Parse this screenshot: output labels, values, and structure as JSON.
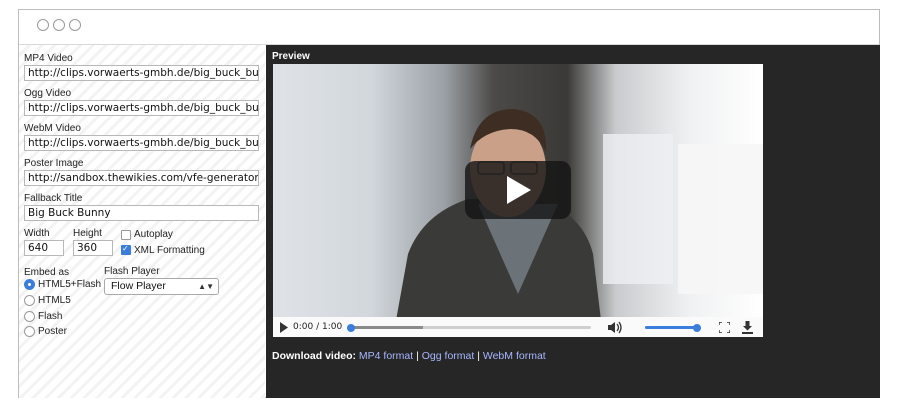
{
  "window": {
    "traffic_lights": [
      "circle-icon",
      "circle-icon",
      "circle-icon"
    ]
  },
  "form": {
    "mp4_label": "MP4 Video",
    "mp4_value": "http://clips.vorwaerts-gmbh.de/big_buck_bunny",
    "ogg_label": "Ogg Video",
    "ogg_value": "http://clips.vorwaerts-gmbh.de/big_buck_bunny",
    "webm_label": "WebM Video",
    "webm_value": "http://clips.vorwaerts-gmbh.de/big_buck_bunny",
    "poster_label": "Poster Image",
    "poster_value": "http://sandbox.thewikies.com/vfe-generator/im",
    "fallback_label": "Fallback Title",
    "fallback_value": "Big Buck Bunny",
    "width_label": "Width",
    "width_value": "640",
    "height_label": "Height",
    "height_value": "360",
    "autoplay_label": "Autoplay",
    "autoplay_checked": false,
    "xml_label": "XML Formatting",
    "xml_checked": true,
    "embed_label": "Embed as",
    "embed_options": [
      "HTML5+Flash",
      "HTML5",
      "Flash",
      "Poster"
    ],
    "embed_selected": "HTML5+Flash",
    "flash_label": "Flash Player",
    "flash_value": "Flow Player"
  },
  "preview": {
    "title": "Preview",
    "time": "0:00 / 1:00",
    "progress_fraction": 0.3,
    "volume_fraction": 1.0,
    "icons": [
      "play-icon",
      "volume-icon",
      "fullscreen-icon",
      "download-icon",
      "play-overlay-icon"
    ],
    "download_prefix": "Download video:",
    "download_links": [
      "MP4 format",
      "Ogg format",
      "WebM format"
    ],
    "separator": "|",
    "accent_color": "#3b7ddd",
    "link_color": "#a8b7ff"
  }
}
